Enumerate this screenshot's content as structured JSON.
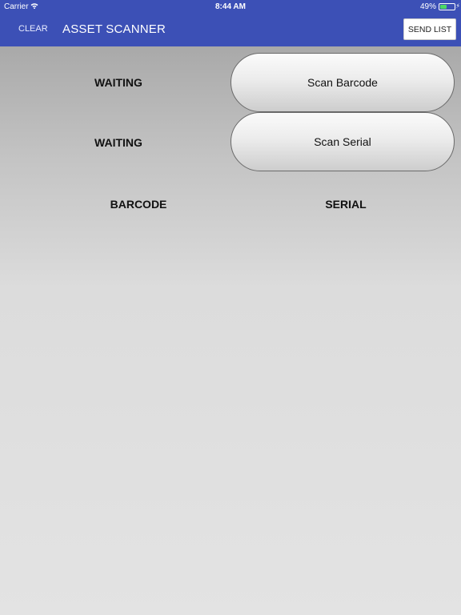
{
  "status_bar": {
    "carrier": "Carrier",
    "wifi_icon": "wifi-icon",
    "time": "8:44 AM",
    "battery_percent": "49%",
    "battery_level": 0.49,
    "battery_icon": "battery-charging-icon"
  },
  "nav": {
    "clear_label": "CLEAR",
    "title": "ASSET SCANNER",
    "send_list_label": "SEND LIST",
    "background_color": "#3c50b6"
  },
  "barcode": {
    "status": "WAITING",
    "button_label": "Scan Barcode"
  },
  "serial": {
    "status": "WAITING",
    "button_label": "Scan Serial"
  },
  "list": {
    "columns": [
      "BARCODE",
      "SERIAL"
    ],
    "rows": []
  }
}
